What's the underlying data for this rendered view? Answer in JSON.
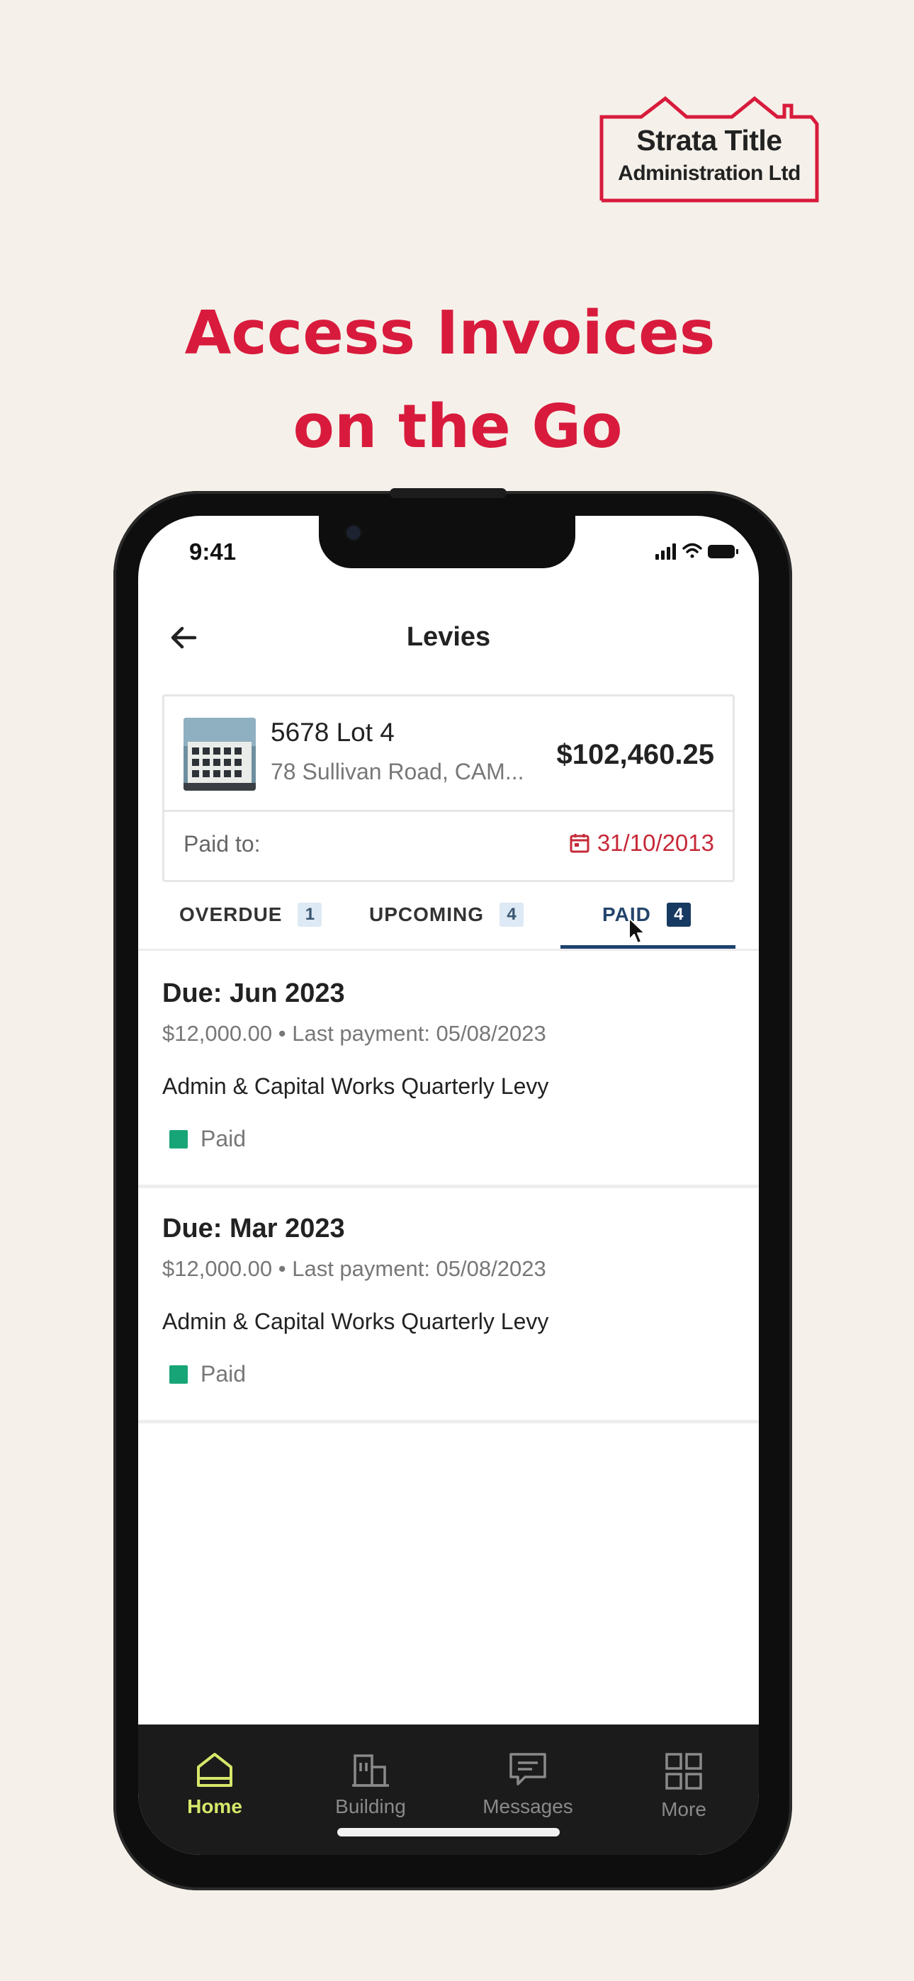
{
  "brand": {
    "line1": "Strata Title",
    "line2": "Administration Ltd",
    "color": "#d81b3c"
  },
  "headline": {
    "line1": "Access Invoices",
    "line2": "on the Go"
  },
  "status_bar": {
    "time": "9:41"
  },
  "header": {
    "title": "Levies"
  },
  "property": {
    "lot": "5678  Lot 4",
    "address": "78 Sullivan Road, CAM...",
    "amount": "$102,460.25",
    "paid_to_label": "Paid to:",
    "paid_to_date": "31/10/2013"
  },
  "tabs": [
    {
      "label": "OVERDUE",
      "count": "1"
    },
    {
      "label": "UPCOMING",
      "count": "4"
    },
    {
      "label": "PAID",
      "count": "4",
      "active": true
    }
  ],
  "levies": [
    {
      "due": "Due: Jun 2023",
      "meta": "$12,000.00  • Last payment: 05/08/2023",
      "description": "Admin & Capital Works Quarterly Levy",
      "status": "Paid",
      "status_color": "#17a577"
    },
    {
      "due": "Due: Mar 2023",
      "meta": "$12,000.00 • Last payment: 05/08/2023",
      "description": "Admin & Capital Works Quarterly Levy",
      "status": "Paid",
      "status_color": "#17a577"
    }
  ],
  "bottom_nav": [
    {
      "label": "Home",
      "icon": "home-icon",
      "active": true
    },
    {
      "label": "Building",
      "icon": "building-icon"
    },
    {
      "label": "Messages",
      "icon": "messages-icon"
    },
    {
      "label": "More",
      "icon": "grid-icon"
    }
  ]
}
